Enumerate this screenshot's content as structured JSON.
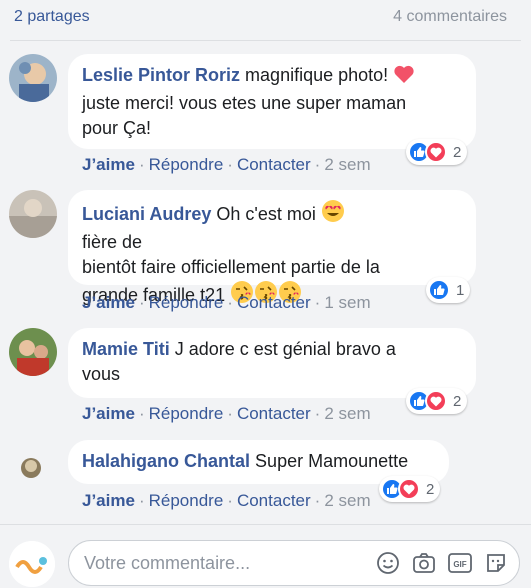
{
  "summary": {
    "shares": "2 partages",
    "comments": "4 commentaires"
  },
  "colors": {
    "link": "#385898",
    "muted": "#8d949e",
    "like": "#1877f2",
    "love": "#f33e58"
  },
  "comments": [
    {
      "author": "Leslie Pintor Roriz",
      "text_parts": [
        "magnifique photo! ",
        "\njuste merci! vous etes une super maman\npour Ça!"
      ],
      "emoji": "heart",
      "time": "2 sem",
      "reactions": [
        "like",
        "love"
      ],
      "reaction_count": "2"
    },
    {
      "author": "Luciani Audrey",
      "text_parts": [
        "Oh c'est moi ",
        " fière de\nbientôt faire officiellement partie de la\ngrande famille t21 "
      ],
      "emoji": "heart-eyes",
      "trailing_emoji": [
        "kiss",
        "kiss",
        "kiss"
      ],
      "time": "1 sem",
      "reactions": [
        "like"
      ],
      "reaction_count": "1"
    },
    {
      "author": "Mamie Titi",
      "text": "J adore c est génial bravo a\nvous",
      "time": "2 sem",
      "reactions": [
        "like",
        "love"
      ],
      "reaction_count": "2"
    },
    {
      "author": "Halahigano Chantal",
      "text": "Super Mamounette",
      "time": "2 sem",
      "reactions": [
        "like",
        "love"
      ],
      "reaction_count": "2"
    }
  ],
  "action_labels": {
    "like": "J’aime",
    "reply": "Répondre",
    "contact": "Contacter",
    "sep": "·"
  },
  "composer": {
    "placeholder": "Votre commentaire...",
    "tools": [
      "emoji-icon",
      "camera-icon",
      "gif-icon",
      "sticker-icon"
    ]
  }
}
